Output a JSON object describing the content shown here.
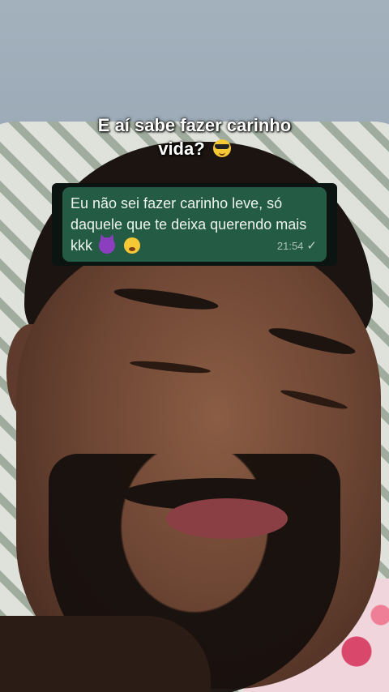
{
  "caption": {
    "line1": "E aí sabe fazer carinho",
    "line2": "vida?",
    "emoji": "smiling-face-with-sunglasses"
  },
  "message": {
    "text": "Eu não sei fazer carinho leve, só daquele que te deixa querendo mais kkk",
    "emojis": [
      "smiling-devil",
      "face-exhaling"
    ],
    "time": "21:54",
    "status_icon": "check-icon",
    "bubble_color": "#235b45"
  }
}
